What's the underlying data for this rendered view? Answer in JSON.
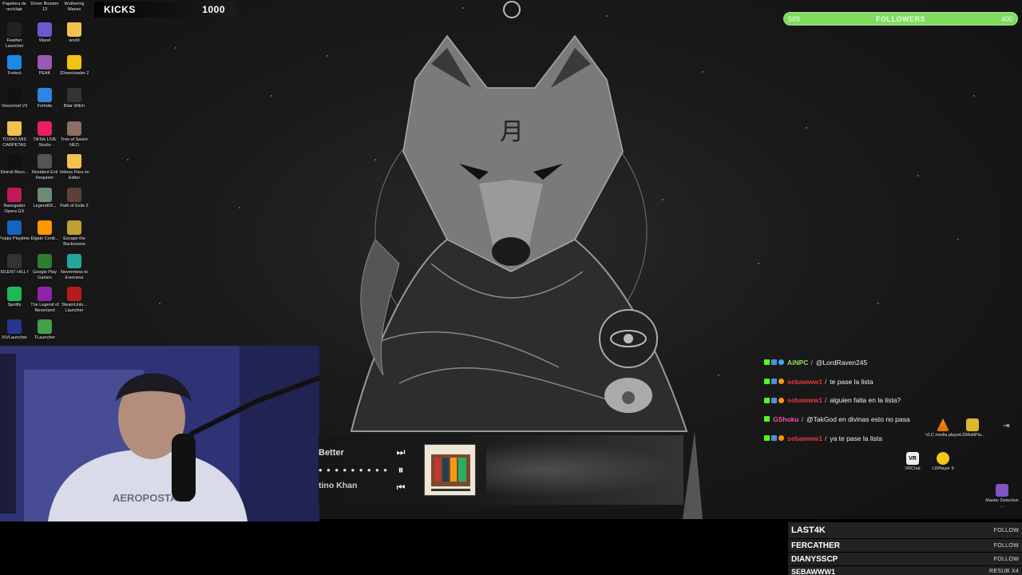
{
  "kicks": {
    "label": "KICKS",
    "value": "1000"
  },
  "followers_goal": {
    "current": "589",
    "label": "FOLLOWERS",
    "target": "400",
    "progress": 1.0,
    "accent": "#7fdc5f"
  },
  "desktop_icons": [
    {
      "label": "Papelera de reciclaje",
      "icon": "trash-icon",
      "color": "#7a8aa0"
    },
    {
      "label": "Driver Booster 13",
      "icon": "driver-icon",
      "color": "#e74c3c"
    },
    {
      "label": "Wuthering Waves",
      "icon": "game-icon",
      "color": "#3b3b5a"
    },
    {
      "label": "Feather Launcher",
      "icon": "feather-icon",
      "color": "#222"
    },
    {
      "label": "Wand",
      "icon": "wand-icon",
      "color": "#6a5acd"
    },
    {
      "label": "world",
      "icon": "folder-icon",
      "color": "#f2c14e"
    },
    {
      "label": "Fortect",
      "icon": "shield-icon",
      "color": "#1e88e5"
    },
    {
      "label": "PEAK",
      "icon": "game-icon",
      "color": "#9b59b6"
    },
    {
      "label": "JDownloader 2",
      "icon": "download-icon",
      "color": "#f1c40f"
    },
    {
      "label": "Voicemod V3",
      "icon": "mic-icon",
      "color": "#111"
    },
    {
      "label": "Fortnite",
      "icon": "game-icon",
      "color": "#2e86de"
    },
    {
      "label": "Blair Witch",
      "icon": "game-icon",
      "color": "#333"
    },
    {
      "label": "TODAS MIS CARPETAS",
      "icon": "folder-icon",
      "color": "#f2c14e"
    },
    {
      "label": "TikTok LIVE Studio",
      "icon": "tiktok-icon",
      "color": "#e91e63"
    },
    {
      "label": "Tree of Savior NEO",
      "icon": "game-icon",
      "color": "#8d6e63"
    },
    {
      "label": "Detroit Beco...",
      "icon": "game-icon",
      "color": "#111"
    },
    {
      "label": "Resident Evil Requiem",
      "icon": "game-icon",
      "color": "#555"
    },
    {
      "label": "Videos Para mi Editor",
      "icon": "folder-icon",
      "color": "#f2c14e"
    },
    {
      "label": "Navegador Opera GX",
      "icon": "browser-icon",
      "color": "#c2185b"
    },
    {
      "label": "LegendOf...",
      "icon": "game-icon",
      "color": "#6d8b74"
    },
    {
      "label": "Path of Exile 2",
      "icon": "game-icon",
      "color": "#5d4037"
    },
    {
      "label": "Poppy Playtime",
      "icon": "game-icon",
      "color": "#1565c0"
    },
    {
      "label": "Elgato Contr...",
      "icon": "elgato-icon",
      "color": "#ff9800"
    },
    {
      "label": "Escape the Backrooms",
      "icon": "game-icon",
      "color": "#c0a030"
    },
    {
      "label": "SILENT HILL f",
      "icon": "game-icon",
      "color": "#333"
    },
    {
      "label": "Google Play Games",
      "icon": "play-icon",
      "color": "#2e7d32"
    },
    {
      "label": "Nevermess to Everness",
      "icon": "game-icon",
      "color": "#26a69a"
    },
    {
      "label": "Spotify",
      "icon": "spotify-icon",
      "color": "#1db954"
    },
    {
      "label": "The Legend of Neverland",
      "icon": "game-icon",
      "color": "#8e24aa"
    },
    {
      "label": "SteamUnlo... Launcher",
      "icon": "steam-icon",
      "color": "#b71c1c"
    },
    {
      "label": "XIVLauncher",
      "icon": "game-icon",
      "color": "#283593"
    },
    {
      "label": "TLauncher",
      "icon": "minecraft-icon",
      "color": "#43a047"
    }
  ],
  "music": {
    "title": "Better",
    "progress_dots": "• • • • • • • • •",
    "artist": "tino Khan",
    "next_icon": "⏭",
    "pause_icon": "⏸",
    "prev_icon": "⏮"
  },
  "chat": [
    {
      "user": "AiNPC",
      "user_color": "#8fe35a",
      "message": "@LordRaven245"
    },
    {
      "user": "sebawww1",
      "user_color": "#e23a3a",
      "message": "te pase la lista"
    },
    {
      "user": "sebawww1",
      "user_color": "#e23a3a",
      "message": "alguien falta en la lista?"
    },
    {
      "user": "GShoku",
      "user_color": "#ff4fa3",
      "message": "@TakGod en divinas esto no pasa"
    },
    {
      "user": "sebawww1",
      "user_color": "#e23a3a",
      "message": "ya te pase la lista"
    }
  ],
  "right_icons": [
    {
      "label": "VLC media player",
      "icon": "vlc-icon"
    },
    {
      "label": "LDMultiPla...",
      "icon": "ldmulti-icon"
    },
    {
      "label": "VRChat",
      "icon": "vrchat-icon"
    },
    {
      "label": "LDPlayer 9",
      "icon": "ldplayer-icon"
    },
    {
      "label": "Master Detective ...",
      "icon": "game-icon"
    }
  ],
  "follow_list": [
    {
      "name": "LAST4K",
      "action": "FOLLOW"
    },
    {
      "name": "FERCATHER",
      "action": "FOLLOW"
    },
    {
      "name": "DIANYSSCP",
      "action": "FOLLOW"
    },
    {
      "name": "SEBAWWW1",
      "action": "RESUB X4"
    }
  ]
}
